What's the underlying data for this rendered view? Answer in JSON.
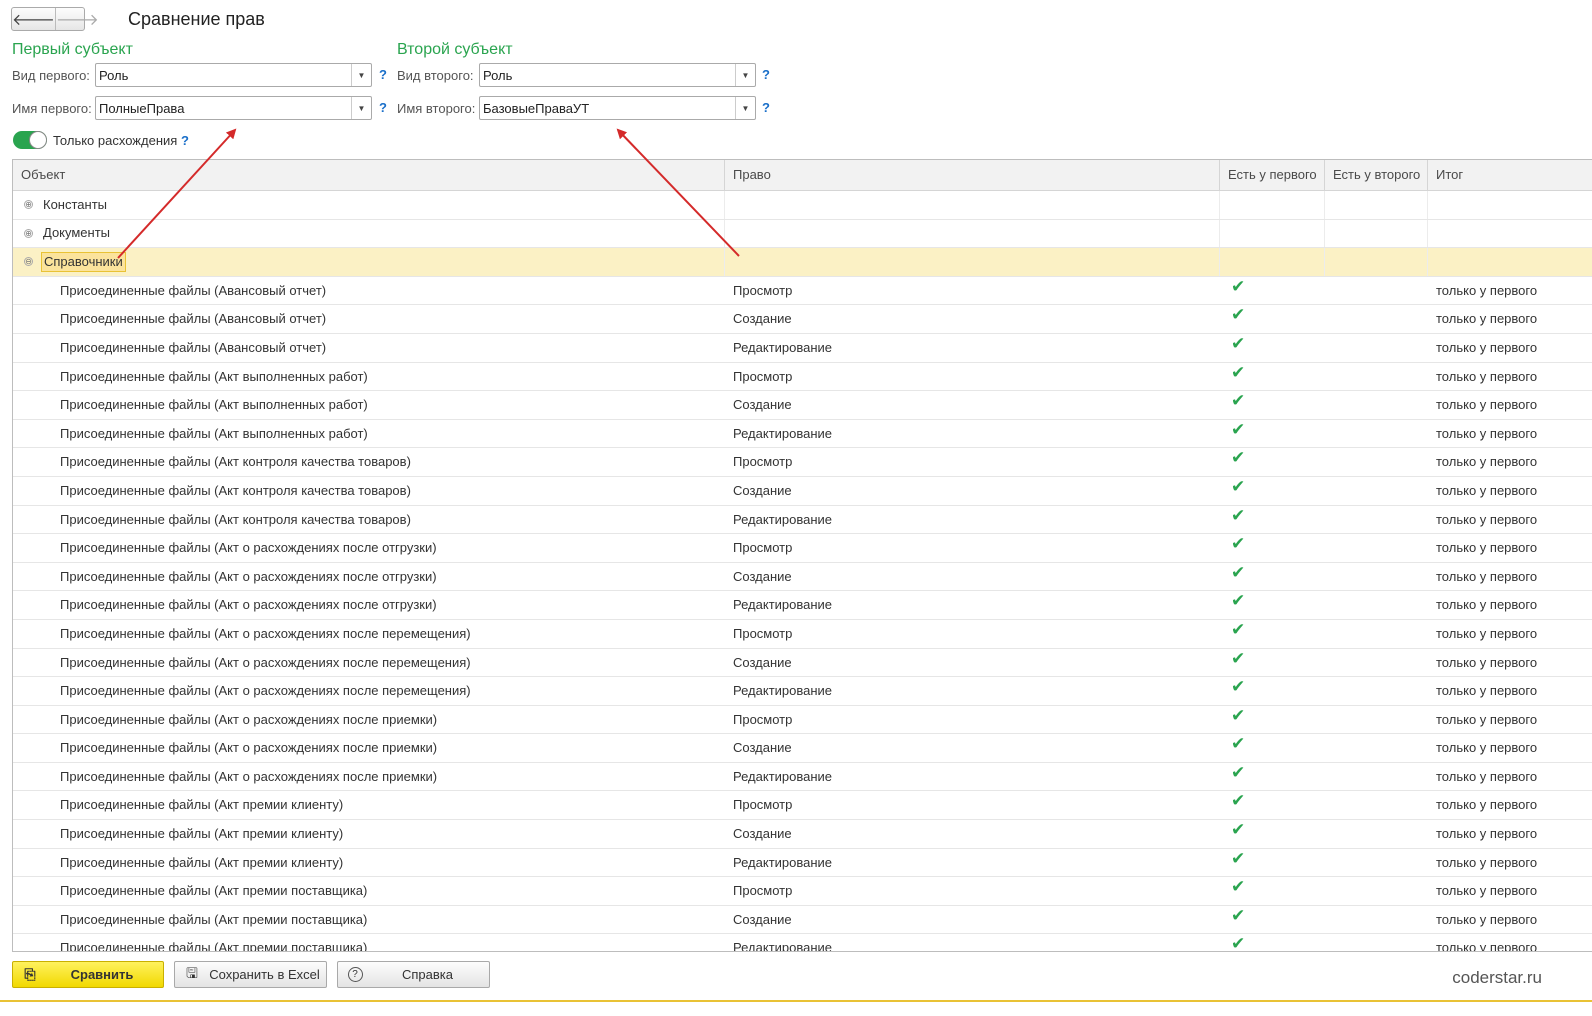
{
  "nav": {
    "back_icon": "arrow-left-icon",
    "forward_icon": "arrow-right-icon",
    "back_glyph": "🡐",
    "forward_glyph": "🡒"
  },
  "window": {
    "title": "Сравнение прав"
  },
  "first": {
    "section_title": "Первый субъект",
    "kind_label": "Вид первого:",
    "kind_value": "Роль",
    "name_label": "Имя первого:",
    "name_value": "ПолныеПрава"
  },
  "second": {
    "section_title": "Второй субъект",
    "kind_label": "Вид второго:",
    "kind_value": "Роль",
    "name_label": "Имя второго:",
    "name_value": "БазовыеПраваУТ"
  },
  "help_glyph": "?",
  "dropdown_glyph": "▼",
  "toggle": {
    "label": "Только расхождения",
    "on": true
  },
  "table": {
    "columns": [
      "Объект",
      "Право",
      "Есть у первого",
      "Есть у второго",
      "Итог"
    ],
    "groups": [
      {
        "label": "Константы",
        "expander": "⊕",
        "expanded": false,
        "selected": false
      },
      {
        "label": "Документы",
        "expander": "⊕",
        "expanded": false,
        "selected": false
      },
      {
        "label": "Справочники",
        "expander": "⊖",
        "expanded": true,
        "selected": true
      }
    ],
    "check_glyph": "✔",
    "rows": [
      {
        "object": "Присоединенные файлы (Авансовый отчет)",
        "right": "Просмотр",
        "first": true,
        "second": false,
        "result": "только у первого"
      },
      {
        "object": "Присоединенные файлы (Авансовый отчет)",
        "right": "Создание",
        "first": true,
        "second": false,
        "result": "только у первого"
      },
      {
        "object": "Присоединенные файлы (Авансовый отчет)",
        "right": "Редактирование",
        "first": true,
        "second": false,
        "result": "только у первого"
      },
      {
        "object": "Присоединенные файлы (Акт выполненных работ)",
        "right": "Просмотр",
        "first": true,
        "second": false,
        "result": "только у первого"
      },
      {
        "object": "Присоединенные файлы (Акт выполненных работ)",
        "right": "Создание",
        "first": true,
        "second": false,
        "result": "только у первого"
      },
      {
        "object": "Присоединенные файлы (Акт выполненных работ)",
        "right": "Редактирование",
        "first": true,
        "second": false,
        "result": "только у первого"
      },
      {
        "object": "Присоединенные файлы (Акт контроля качества товаров)",
        "right": "Просмотр",
        "first": true,
        "second": false,
        "result": "только у первого"
      },
      {
        "object": "Присоединенные файлы (Акт контроля качества товаров)",
        "right": "Создание",
        "first": true,
        "second": false,
        "result": "только у первого"
      },
      {
        "object": "Присоединенные файлы (Акт контроля качества товаров)",
        "right": "Редактирование",
        "first": true,
        "second": false,
        "result": "только у первого"
      },
      {
        "object": "Присоединенные файлы (Акт о расхождениях после отгрузки)",
        "right": "Просмотр",
        "first": true,
        "second": false,
        "result": "только у первого"
      },
      {
        "object": "Присоединенные файлы (Акт о расхождениях после отгрузки)",
        "right": "Создание",
        "first": true,
        "second": false,
        "result": "только у первого"
      },
      {
        "object": "Присоединенные файлы (Акт о расхождениях после отгрузки)",
        "right": "Редактирование",
        "first": true,
        "second": false,
        "result": "только у первого"
      },
      {
        "object": "Присоединенные файлы (Акт о расхождениях после перемещения)",
        "right": "Просмотр",
        "first": true,
        "second": false,
        "result": "только у первого"
      },
      {
        "object": "Присоединенные файлы (Акт о расхождениях после перемещения)",
        "right": "Создание",
        "first": true,
        "second": false,
        "result": "только у первого"
      },
      {
        "object": "Присоединенные файлы (Акт о расхождениях после перемещения)",
        "right": "Редактирование",
        "first": true,
        "second": false,
        "result": "только у первого"
      },
      {
        "object": "Присоединенные файлы (Акт о расхождениях после приемки)",
        "right": "Просмотр",
        "first": true,
        "second": false,
        "result": "только у первого"
      },
      {
        "object": "Присоединенные файлы (Акт о расхождениях после приемки)",
        "right": "Создание",
        "first": true,
        "second": false,
        "result": "только у первого"
      },
      {
        "object": "Присоединенные файлы (Акт о расхождениях после приемки)",
        "right": "Редактирование",
        "first": true,
        "second": false,
        "result": "только у первого"
      },
      {
        "object": "Присоединенные файлы (Акт премии клиенту)",
        "right": "Просмотр",
        "first": true,
        "second": false,
        "result": "только у первого"
      },
      {
        "object": "Присоединенные файлы (Акт премии клиенту)",
        "right": "Создание",
        "first": true,
        "second": false,
        "result": "только у первого"
      },
      {
        "object": "Присоединенные файлы (Акт премии клиенту)",
        "right": "Редактирование",
        "first": true,
        "second": false,
        "result": "только у первого"
      },
      {
        "object": "Присоединенные файлы (Акт премии поставщика)",
        "right": "Просмотр",
        "first": true,
        "second": false,
        "result": "только у первого"
      },
      {
        "object": "Присоединенные файлы (Акт премии поставщика)",
        "right": "Создание",
        "first": true,
        "second": false,
        "result": "только у первого"
      },
      {
        "object": "Присоединенные файлы (Акт премии поставщика)",
        "right": "Редактирование",
        "first": true,
        "second": false,
        "result": "только у первого"
      }
    ]
  },
  "buttons": {
    "compare": {
      "label": "Сравнить",
      "icon": "compare-icon",
      "glyph": "⎘"
    },
    "save_excel": {
      "label": "Сохранить в Excel",
      "icon": "save-icon",
      "glyph": "🖫"
    },
    "help": {
      "label": "Справка",
      "icon": "help-circle-icon",
      "glyph": "?"
    }
  },
  "watermark": "coderstar.ru",
  "colors": {
    "accent_green": "#2aa44f",
    "selection": "#fbf1c5",
    "primary_button": "#f1d900",
    "annotation_arrow": "#d42a2a"
  }
}
